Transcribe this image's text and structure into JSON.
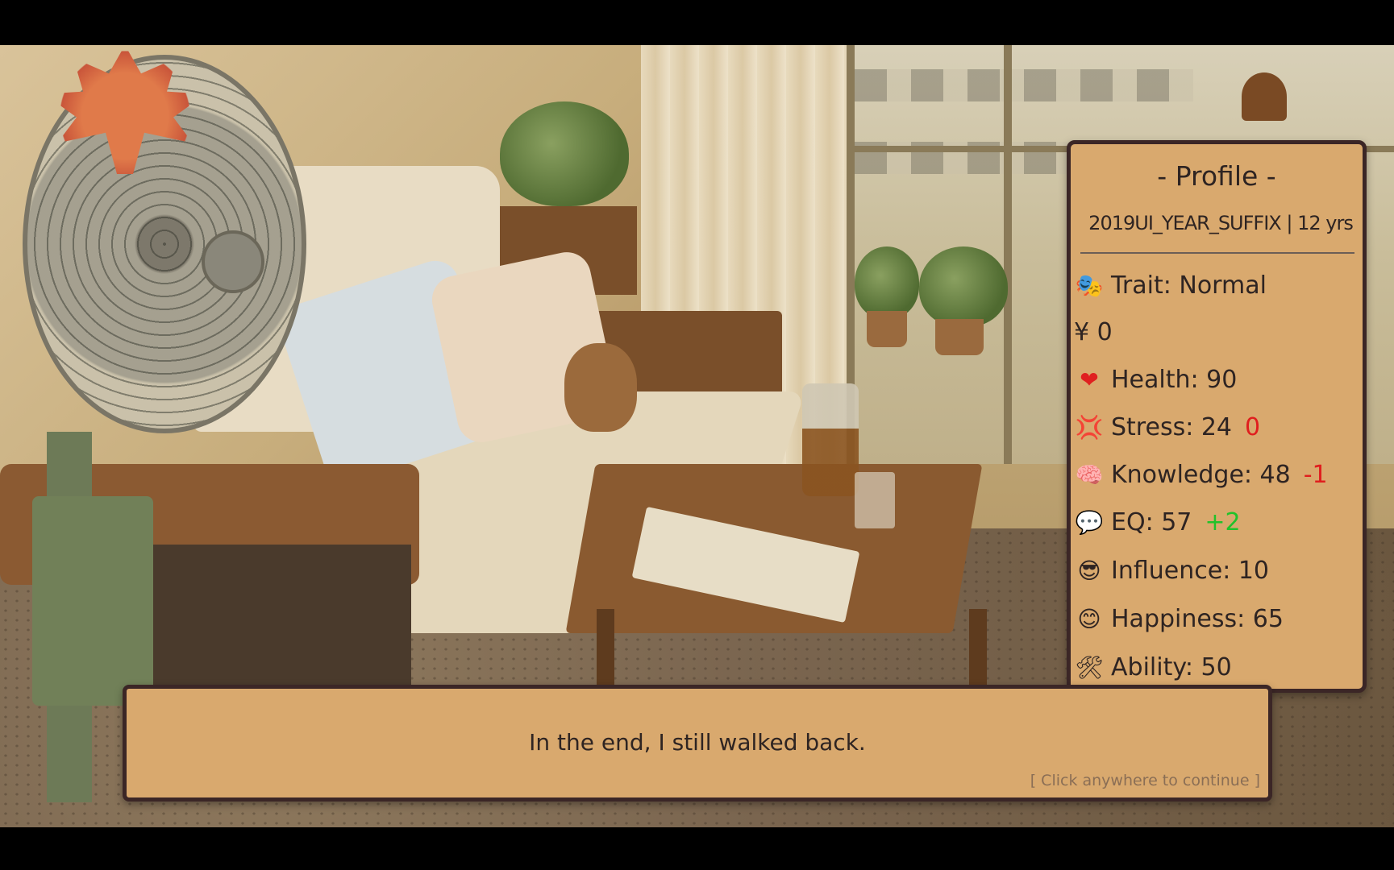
{
  "profile": {
    "title": "- Profile -",
    "subtitle": "2019UI_YEAR_SUFFIX | 12 yrs",
    "stats": [
      {
        "icon": "masks-icon",
        "glyph": "🎭",
        "label": "Trait: Normal",
        "delta": ""
      },
      {
        "icon": "",
        "glyph": "",
        "label": "¥ 0",
        "delta": ""
      },
      {
        "icon": "heart-icon",
        "glyph": "❤",
        "label": "Health: 90",
        "delta": ""
      },
      {
        "icon": "anger-icon",
        "glyph": "💢",
        "label": "Stress: 24",
        "delta": "0"
      },
      {
        "icon": "brain-icon",
        "glyph": "🧠",
        "label": "Knowledge: 48",
        "delta": "-1"
      },
      {
        "icon": "speech-bubble-icon",
        "glyph": "💬",
        "label": "EQ: 57",
        "delta": "+2"
      },
      {
        "icon": "sunglasses-face-icon",
        "glyph": "😎",
        "label": "Influence: 10",
        "delta": ""
      },
      {
        "icon": "smile-face-icon",
        "glyph": "😊",
        "label": "Happiness: 65",
        "delta": ""
      },
      {
        "icon": "tools-icon",
        "glyph": "🛠",
        "label": "Ability: 50",
        "delta": ""
      }
    ]
  },
  "dialog": {
    "text": "In the end, I still walked back.",
    "hint": "[ Click anywhere to continue ]"
  },
  "colors": {
    "panel": "#d9a96e",
    "border": "#3b2626",
    "negative": "#e01e1e",
    "positive": "#22c22a"
  }
}
